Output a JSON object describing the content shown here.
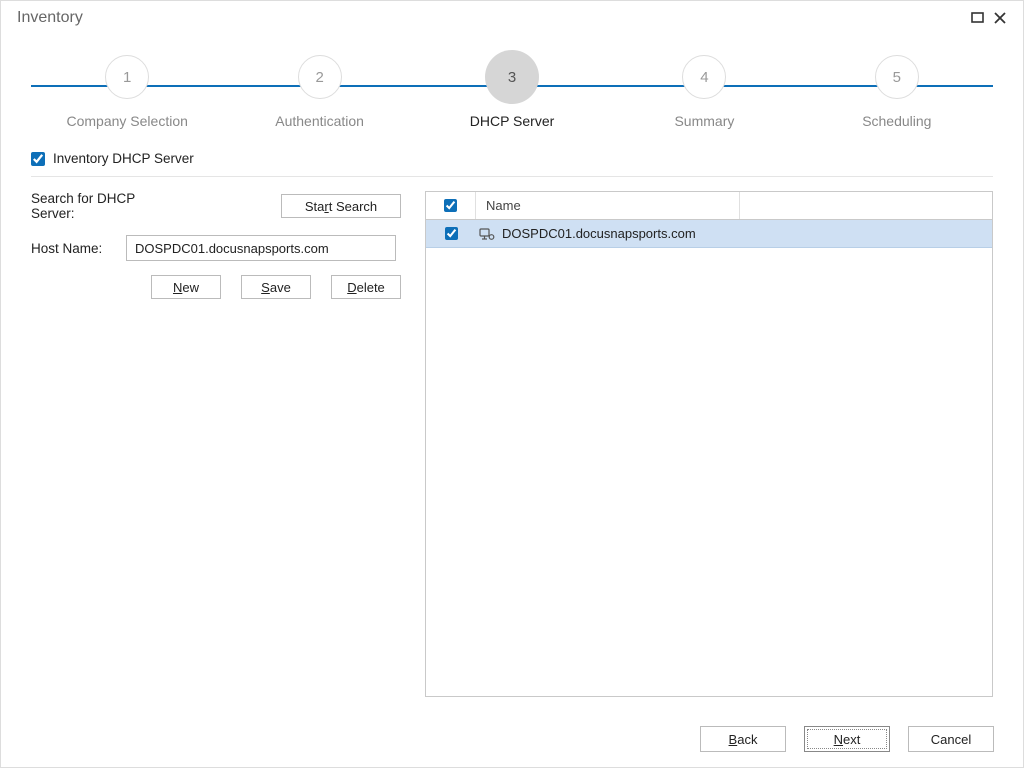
{
  "window": {
    "title": "Inventory"
  },
  "wizard": {
    "steps": [
      {
        "num": "1",
        "label": "Company Selection"
      },
      {
        "num": "2",
        "label": "Authentication"
      },
      {
        "num": "3",
        "label": "DHCP Server"
      },
      {
        "num": "4",
        "label": "Summary"
      },
      {
        "num": "5",
        "label": "Scheduling"
      }
    ],
    "active_index": 2
  },
  "form": {
    "inventory_checkbox_label": "Inventory DHCP Server",
    "inventory_checked": true,
    "search_label": "Search for DHCP Server:",
    "start_search_label": "Start Search",
    "start_search_underline": "r",
    "hostname_label": "Host Name:",
    "hostname_value": "DOSPDC01.docusnapsports.com",
    "btn_new": "New",
    "btn_new_underline": "N",
    "btn_save": "Save",
    "btn_save_underline": "S",
    "btn_delete": "Delete",
    "btn_delete_underline": "D"
  },
  "table": {
    "header_name": "Name",
    "rows": [
      {
        "checked": true,
        "name": "DOSPDC01.docusnapsports.com"
      }
    ]
  },
  "footer": {
    "back": "Back",
    "back_underline": "B",
    "next": "Next",
    "next_underline": "N",
    "cancel": "Cancel"
  }
}
